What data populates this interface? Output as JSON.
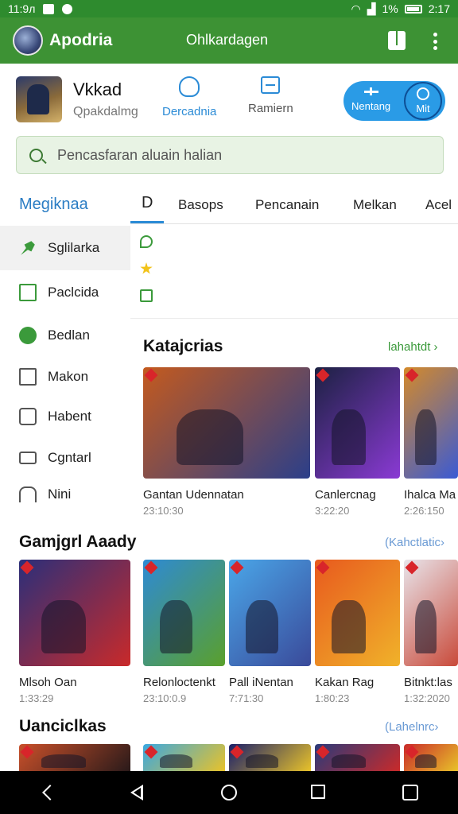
{
  "status_bar": {
    "time": "11:9л",
    "battery_pct": "1%",
    "clock": "2:17"
  },
  "app_bar": {
    "app_name": "Apodria",
    "subtitle": "Ohlkardagen"
  },
  "profile": {
    "title": "Vkkad",
    "subtitle": "Qpakdalmg",
    "action_primary": "Dercadnia",
    "action_secondary": "Ramiern",
    "pill_left": "Nentang",
    "pill_right": "Mit"
  },
  "search": {
    "placeholder": "Pencasfaran aluain halian"
  },
  "sidebar": {
    "title": "Megiknaa",
    "items": [
      {
        "label": "Sglilarka",
        "icon": "pin-icon"
      },
      {
        "label": "Paclcida",
        "icon": "box-icon"
      },
      {
        "label": "Bedlan",
        "icon": "check-circle-icon"
      },
      {
        "label": "Makon",
        "icon": "square-icon"
      },
      {
        "label": "Habent",
        "icon": "bag-icon"
      },
      {
        "label": "Cgntarl",
        "icon": "controller-icon"
      },
      {
        "label": "Nini",
        "icon": "door-icon"
      }
    ]
  },
  "tabs": [
    {
      "label": "D"
    },
    {
      "label": "Basops"
    },
    {
      "label": "Pencanain"
    },
    {
      "label": "Melkan"
    },
    {
      "label": "Acel"
    }
  ],
  "section_1": {
    "title": "Katajcrias",
    "link": "lahahtdt ›",
    "cards": [
      {
        "name": "Gantan Udennatan",
        "meta": "23:10:30",
        "colors": [
          "#c45a1e",
          "#2b3f8a"
        ]
      },
      {
        "name": "Canlercnag",
        "meta": "3:22:20",
        "colors": [
          "#1c2142",
          "#8a3ad4"
        ]
      },
      {
        "name": "Ihalca Ma",
        "meta": "2:26:150",
        "colors": [
          "#d48a2a",
          "#3a5ad4"
        ]
      }
    ]
  },
  "section_2": {
    "title": "Gamjgrl Aaady",
    "link": "(Kahctlatic›",
    "cards": [
      {
        "name": "Mlsoh Oan",
        "meta": "1:33:29",
        "colors": [
          "#2b2f7a",
          "#c92a2a"
        ]
      },
      {
        "name": "Relonloctenkt",
        "meta": "23:10:0.9",
        "colors": [
          "#2e8ad4",
          "#5aa02c"
        ]
      },
      {
        "name": "Pall iNentan",
        "meta": "7:71:30",
        "colors": [
          "#4aa6e8",
          "#3a4a9a"
        ]
      },
      {
        "name": "Kakan Rag",
        "meta": "1:80:23",
        "colors": [
          "#e85a1e",
          "#f0b22a"
        ]
      },
      {
        "name": "Bitnkt:las",
        "meta": "1:32:2020",
        "colors": [
          "#e8e4ea",
          "#c94a3a"
        ]
      }
    ]
  },
  "section_3": {
    "title": "Uanciclkas",
    "link": "(Lahelnrc›",
    "cards": [
      {
        "colors": [
          "#c9502a",
          "#2a1a1a"
        ]
      },
      {
        "colors": [
          "#3aa8e0",
          "#e8c22a"
        ]
      },
      {
        "colors": [
          "#1a1f6a",
          "#e8c22a"
        ]
      },
      {
        "colors": [
          "#2a3a7a",
          "#c92a2a"
        ]
      },
      {
        "colors": [
          "#c92a2a",
          "#e8c22a"
        ]
      }
    ]
  },
  "nav_bar": [
    "back-gesture-icon",
    "back-triangle-icon",
    "home-icon",
    "recents-icon",
    "edit-icon"
  ],
  "colors": {
    "header_green": "#3d9234",
    "accent_blue": "#2b8bd6",
    "link_green": "#3b9a3b"
  }
}
